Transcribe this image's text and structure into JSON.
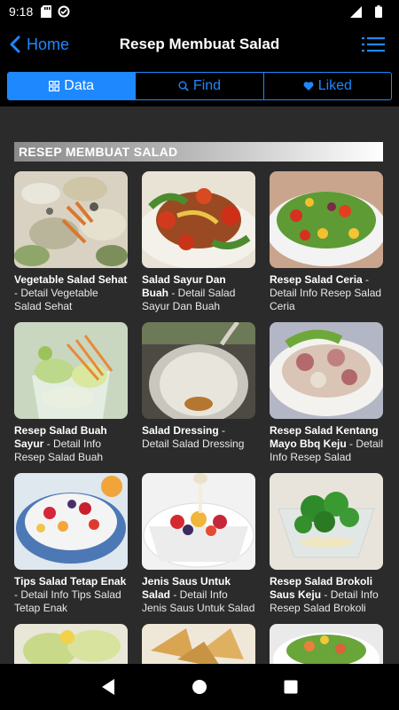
{
  "status_bar": {
    "time": "9:18"
  },
  "app_bar": {
    "back_label": "Home",
    "title": "Resep Membuat Salad"
  },
  "tabs": [
    {
      "label": "Data",
      "icon": "grid-icon",
      "active": true
    },
    {
      "label": "Find",
      "icon": "search-icon",
      "active": false
    },
    {
      "label": "Liked",
      "icon": "heart-icon",
      "active": false
    }
  ],
  "section": {
    "title": "RESEP MEMBUAT SALAD"
  },
  "items": [
    {
      "title": "Vegetable Salad Sehat",
      "desc": " - Detail Vegetable Salad Sehat"
    },
    {
      "title": "Salad Sayur Dan Buah",
      "desc": " - Detail Salad Sayur Dan Buah"
    },
    {
      "title": "Resep Salad Ceria",
      "desc": " - Detail Info Resep Salad Ceria"
    },
    {
      "title": "Resep Salad Buah Sayur",
      "desc": " - Detail Info Resep Salad Buah"
    },
    {
      "title": "Salad Dressing",
      "desc": " - Detail Salad Dressing"
    },
    {
      "title": "Resep Salad Kentang Mayo Bbq Keju",
      "desc": " - Detail Info Resep Salad"
    },
    {
      "title": "Tips Salad Tetap Enak",
      "desc": " - Detail Info Tips Salad Tetap Enak"
    },
    {
      "title": "Jenis Saus Untuk Salad",
      "desc": " - Detail Info Jenis Saus Untuk Salad"
    },
    {
      "title": "Resep Salad Brokoli Saus Keju",
      "desc": " - Detail Info Resep Salad Brokoli"
    },
    {
      "title": "",
      "desc": ""
    },
    {
      "title": "",
      "desc": ""
    },
    {
      "title": "",
      "desc": ""
    }
  ],
  "colors": {
    "accent": "#1e88ff",
    "background": "#2b2b2b"
  }
}
